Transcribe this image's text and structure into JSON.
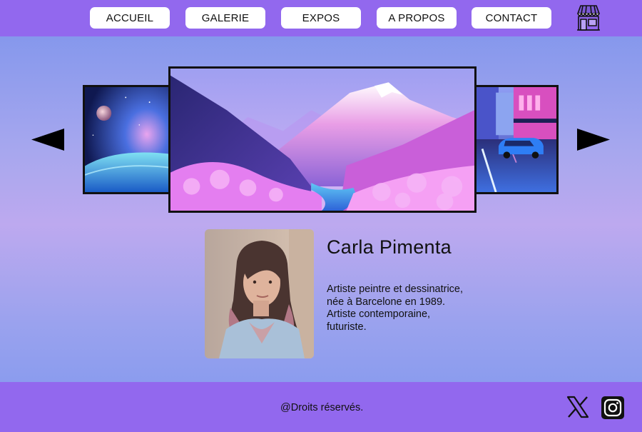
{
  "nav": {
    "items": [
      {
        "label": "ACCUEIL"
      },
      {
        "label": "GALERIE"
      },
      {
        "label": "EXPOS"
      },
      {
        "label": "A PROPOS"
      },
      {
        "label": "CONTACT"
      }
    ],
    "shop_icon": "storefront-icon"
  },
  "carousel": {
    "prev_icon": "arrow-left-icon",
    "next_icon": "arrow-right-icon",
    "slides": [
      {
        "subject": "space-planet-artwork"
      },
      {
        "subject": "pink-mountain-valley-artwork"
      },
      {
        "subject": "neon-city-car-artwork"
      }
    ]
  },
  "artist": {
    "name": "Carla Pimenta",
    "bio_lines": [
      "Artiste peintre et dessinatrice,",
      "née à Barcelone en 1989.",
      "Artiste contemporaine,",
      "futuriste."
    ]
  },
  "footer": {
    "copyright": "@Droits réservés.",
    "social": [
      "x-icon",
      "instagram-icon"
    ]
  },
  "colors": {
    "bar": "#9268ee",
    "button_bg": "#ffffff",
    "frame": "#111111"
  }
}
